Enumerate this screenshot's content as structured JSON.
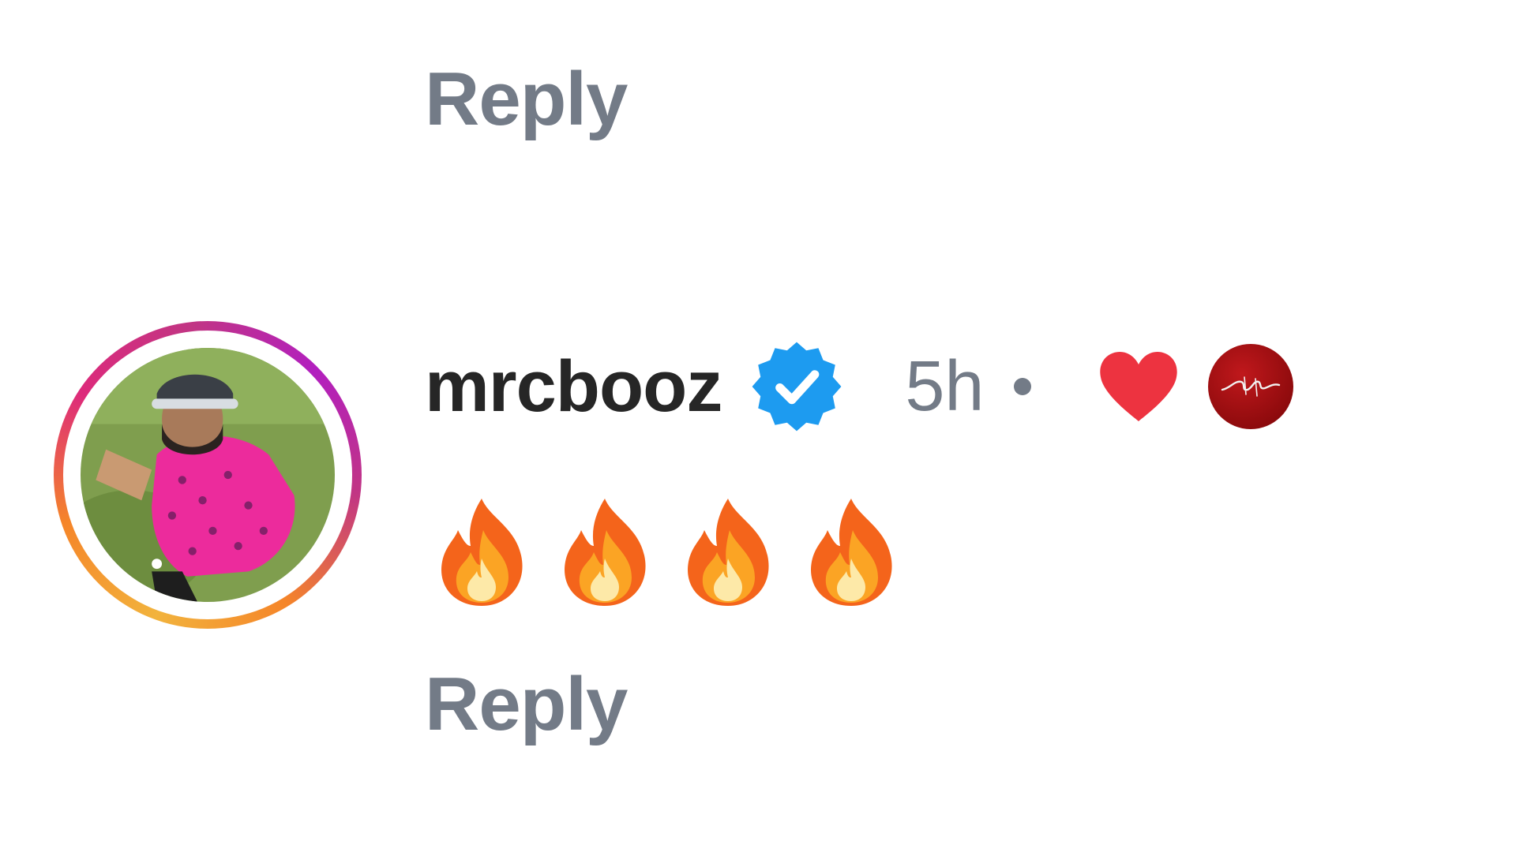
{
  "previous_comment": {
    "reply_label": "Reply"
  },
  "comment": {
    "username": "mrcbooz",
    "verified_icon": "verified-badge-icon",
    "timestamp": "5h",
    "separator": "•",
    "liked_by_author_icon": "heart-icon",
    "text": "🔥🔥🔥🔥",
    "reply_label": "Reply"
  },
  "colors": {
    "username": "#262626",
    "secondary_text": "#737b87",
    "verified_blue": "#1d9bf0",
    "heart_red": "#ed3340",
    "author_avatar_red": "#a8141a"
  }
}
